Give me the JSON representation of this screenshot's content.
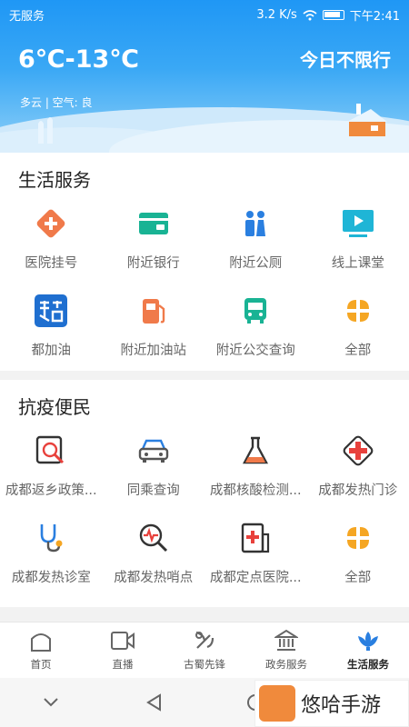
{
  "status_bar": {
    "carrier": "无服务",
    "speed": "3.2 K/s",
    "time": "下午2:41"
  },
  "weather": {
    "temperature": "6℃-13℃",
    "detail": "多云 | 空气: 良",
    "limit": "今日不限行"
  },
  "life_services": {
    "title": "生活服务",
    "items": [
      {
        "label": "医院挂号",
        "icon": "hospital-icon"
      },
      {
        "label": "附近银行",
        "icon": "bank-card-icon"
      },
      {
        "label": "附近公厕",
        "icon": "toilet-icon"
      },
      {
        "label": "线上课堂",
        "icon": "online-class-icon"
      },
      {
        "label": "都加油",
        "icon": "du-jiayou-logo-icon"
      },
      {
        "label": "附近加油站",
        "icon": "gas-station-icon"
      },
      {
        "label": "附近公交查询",
        "icon": "bus-icon"
      },
      {
        "label": "全部",
        "icon": "all-grid-icon"
      }
    ]
  },
  "epidemic": {
    "title": "抗疫便民",
    "items": [
      {
        "label": "成都返乡政策...",
        "icon": "policy-search-icon"
      },
      {
        "label": "同乘查询",
        "icon": "car-icon"
      },
      {
        "label": "成都核酸检测...",
        "icon": "flask-icon"
      },
      {
        "label": "成都发热门诊",
        "icon": "red-cross-icon"
      },
      {
        "label": "成都发热诊室",
        "icon": "stethoscope-icon"
      },
      {
        "label": "成都发热哨点",
        "icon": "pulse-search-icon"
      },
      {
        "label": "成都定点医院...",
        "icon": "hospital-building-icon"
      },
      {
        "label": "全部",
        "icon": "all-grid-icon"
      }
    ]
  },
  "bottom_nav": [
    {
      "label": "首页",
      "icon": "home-icon"
    },
    {
      "label": "直播",
      "icon": "video-icon"
    },
    {
      "label": "古蜀先锋",
      "icon": "party-emblem-icon"
    },
    {
      "label": "政务服务",
      "icon": "government-icon"
    },
    {
      "label": "生活服务",
      "icon": "lotus-icon",
      "active": true
    }
  ],
  "watermark": {
    "text": "悠哈手游"
  },
  "colors": {
    "accent_blue": "#2a7fe0",
    "orange": "#f08a3c",
    "red": "#e8413c",
    "green": "#19b394"
  }
}
